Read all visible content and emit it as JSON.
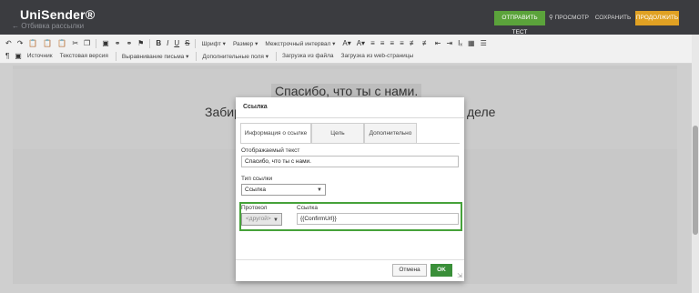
{
  "header": {
    "logo": "UniSender®",
    "back_link": "← Отбивка рассылки",
    "send_test": "Отправить тест",
    "preview": "Просмотр",
    "save": "Сохранить",
    "continue": "Продолжить"
  },
  "toolbar": {
    "font": "Шрифт",
    "size": "Размер",
    "line_spacing": "Межстрочный интервал",
    "source": "Источник",
    "text_version": "Текстовая версия",
    "align_letter": "Выравнивание письма",
    "extra_fields": "Дополнительные поля",
    "load_file": "Загрузка из файла",
    "load_web": "Загрузка из web-страницы"
  },
  "content": {
    "heading1": "Спасибо, что ты с нами.",
    "heading2_left": "Забир",
    "heading2_right": "деле"
  },
  "dialog": {
    "title": "Ссылка",
    "tabs": [
      "Информация о ссылке",
      "Цель",
      "Дополнительно"
    ],
    "display_text_label": "Отображаемый текст",
    "display_text_value": "Спасибо, что ты с нами.",
    "link_type_label": "Тип ссылки",
    "link_type_value": "Ссылка",
    "protocol_label": "Протокол",
    "protocol_value": "<другой>",
    "url_label": "Ссылка",
    "url_value": "{{ConfirmUrl}}",
    "cancel": "Отмена",
    "ok": "OK"
  },
  "colors": {
    "header_bg": "#3b3c40",
    "send_test_bg": "#5ba33b",
    "continue_bg": "#e0a123",
    "ok_bg": "#3a8f39",
    "highlight_border": "#46a23a"
  }
}
